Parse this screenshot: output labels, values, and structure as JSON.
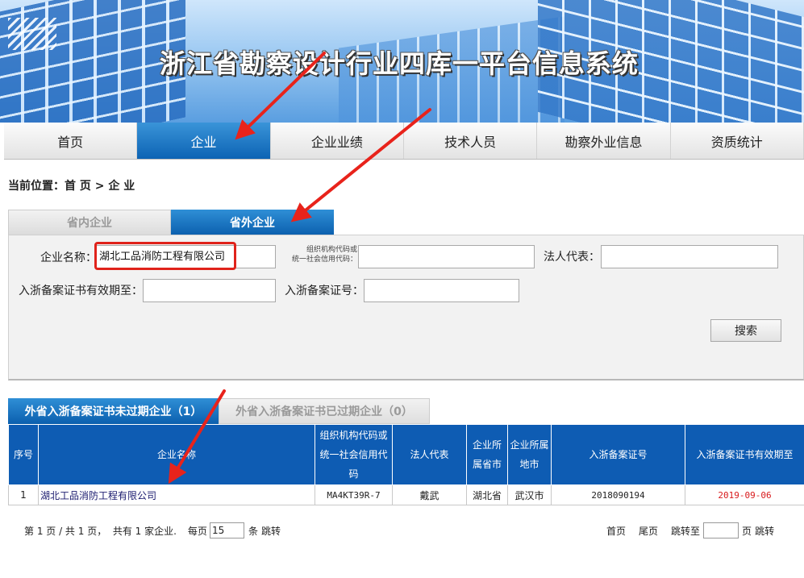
{
  "header": {
    "title": "浙江省勘察设计行业四库一平台信息系统"
  },
  "nav": {
    "items": [
      {
        "label": "首页"
      },
      {
        "label": "企业"
      },
      {
        "label": "企业业绩"
      },
      {
        "label": "技术人员"
      },
      {
        "label": "勘察外业信息"
      },
      {
        "label": "资质统计"
      }
    ],
    "active_index": 1
  },
  "breadcrumb": "当前位置：首 页 > 企 业",
  "region_tabs": {
    "inside": "省内企业",
    "outside": "省外企业",
    "active": "outside"
  },
  "search": {
    "company_name_label": "企业名称：",
    "company_name_value": "湖北工品消防工程有限公司",
    "org_code_label_line1": "组织机构代码或",
    "org_code_label_line2": "统一社会信用代码：",
    "org_code_value": "",
    "legal_rep_label": "法人代表：",
    "legal_rep_value": "",
    "cert_valid_label": "入浙备案证书有效期至：",
    "cert_valid_value": "",
    "cert_no_label": "入浙备案证号：",
    "cert_no_value": "",
    "search_button": "搜索"
  },
  "result_tabs": {
    "valid": "外省入浙备案证书未过期企业（1）",
    "expired": "外省入浙备案证书已过期企业（0）",
    "active": "valid"
  },
  "table": {
    "headers": [
      "序号",
      "企业名称",
      "组织机构代码或统一社会信用代码",
      "法人代表",
      "企业所属省市",
      "企业所属地市",
      "入浙备案证号",
      "入浙备案证书有效期至"
    ],
    "rows": [
      {
        "index": "1",
        "name": "湖北工品消防工程有限公司",
        "code": "MA4KT39R-7",
        "legal_rep": "戴武",
        "province": "湖北省",
        "city": "武汉市",
        "cert_no": "2018090194",
        "expiry": "2019-09-06"
      }
    ]
  },
  "pager": {
    "summary": "第 1 页 / 共 1 页，  共有 1 家企业.",
    "per_page_label": "每页",
    "per_page_value": "15",
    "per_page_unit": "条",
    "jump_label": "跳转",
    "first": "首页",
    "last": "尾页",
    "goto_label": "跳转至",
    "page_unit": "页",
    "go": "跳转"
  },
  "colors": {
    "primary_blue": "#0e5cb3",
    "highlight_red": "#e0231b",
    "expiry_red": "#d8191b"
  }
}
